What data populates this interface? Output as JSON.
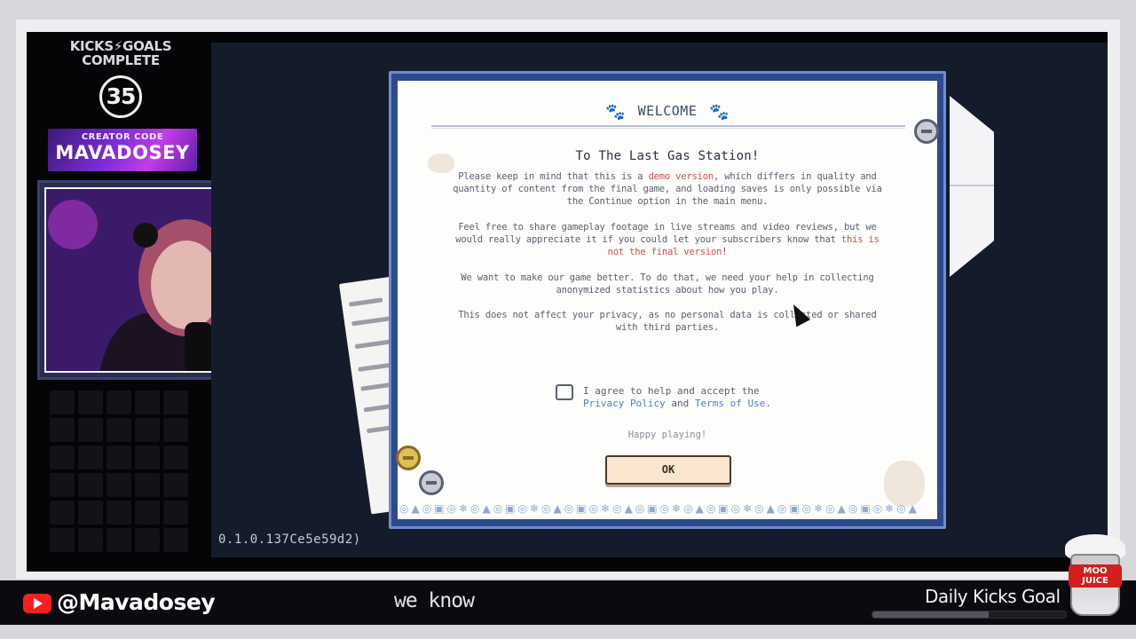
{
  "overlay": {
    "goal_title_line1": "KICKS⚡GOALS",
    "goal_title_line2": "COMPLETE",
    "goal_count": "35",
    "creator_code_label": "CREATOR CODE",
    "creator_code_name": "MAVADOSEY"
  },
  "game": {
    "version": "0.1.0.137Ce5e59d2)",
    "dialog": {
      "header": "WELCOME",
      "title": "To The Last Gas Station!",
      "p1_a": "Please keep in mind that this is a ",
      "p1_red": "demo version",
      "p1_b": ", which differs in quality and quantity of content from the final game, and loading saves is only possible via the Continue option in the main menu.",
      "p2_a": "Feel free to share gameplay footage in live streams and video reviews, but we would really appreciate it if you could let your subscribers know that ",
      "p2_red": "this is not the final version",
      "p2_b": "!",
      "p3": "We want to make our game better. To do that, we need your help in collecting anonymized statistics about how you play.",
      "p4": "This does not affect your privacy, as no personal data is collected or shared with third parties.",
      "agree_a": "I agree to help and accept the",
      "privacy_link": "Privacy Policy",
      "agree_and": " and ",
      "terms_link": "Terms of Use",
      "agree_end": ".",
      "happy": "Happy playing!",
      "ok_label": "OK",
      "checkbox_checked": false
    }
  },
  "bottom_bar": {
    "handle": "@Mavadosey",
    "subtitle": "we know",
    "daily_goal": "Daily Kicks Goal",
    "daily_goal_progress": 0.6,
    "logo_text": "MOO JUICE"
  },
  "colors": {
    "dialog_border": "#2e4a8e",
    "link": "#4b7ec8",
    "warning_red": "#d64a4a",
    "ok_button": "#fbe6d0"
  }
}
